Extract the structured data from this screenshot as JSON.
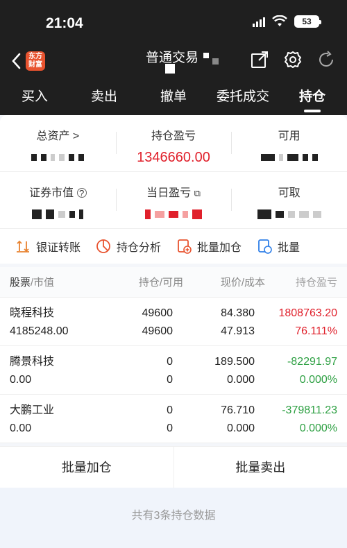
{
  "status": {
    "time": "21:04",
    "battery": "53"
  },
  "nav": {
    "logo": "东方财富",
    "title": "普通交易"
  },
  "tabs": [
    {
      "label": "买入"
    },
    {
      "label": "卖出"
    },
    {
      "label": "撤单"
    },
    {
      "label": "委托成交"
    },
    {
      "label": "持仓"
    }
  ],
  "summary": {
    "total_assets_label": "总资产 >",
    "holding_pnl_label": "持仓盈亏",
    "holding_pnl_value": "1346660.00",
    "available_label": "可用",
    "market_value_label": "证券市值",
    "daily_pnl_label": "当日盈亏",
    "withdrawable_label": "可取"
  },
  "actions": [
    {
      "label": "银证转账",
      "icon": "transfer-icon"
    },
    {
      "label": "持仓分析",
      "icon": "analysis-icon"
    },
    {
      "label": "批量加仓",
      "icon": "add-position-icon"
    },
    {
      "label": "批量",
      "icon": "batch-icon"
    }
  ],
  "table": {
    "headers": {
      "stock": "股票",
      "stock_sub": "/市值",
      "position": "持仓/可用",
      "price": "现价/成本",
      "pnl": "持仓盈亏"
    },
    "rows": [
      {
        "name": "晓程科技",
        "market_value": "4185248.00",
        "holding": "49600",
        "available": "49600",
        "price": "84.380",
        "cost": "47.913",
        "pnl": "1808763.20",
        "pnl_pct": "76.111%",
        "sign": "up"
      },
      {
        "name": "腾景科技",
        "market_value": "0.00",
        "holding": "0",
        "available": "0",
        "price": "189.500",
        "cost": "0.000",
        "pnl": "-82291.97",
        "pnl_pct": "0.000%",
        "sign": "down"
      },
      {
        "name": "大鹏工业",
        "market_value": "0.00",
        "holding": "0",
        "available": "0",
        "price": "76.710",
        "cost": "0.000",
        "pnl": "-379811.23",
        "pnl_pct": "0.000%",
        "sign": "down"
      }
    ]
  },
  "bottom": {
    "batch_add": "批量加仓",
    "batch_sell": "批量卖出"
  },
  "footer": "共有3条持仓数据",
  "colors": {
    "up": "#e0202b",
    "down": "#2ea043",
    "header_bg": "#1f1f1f"
  }
}
